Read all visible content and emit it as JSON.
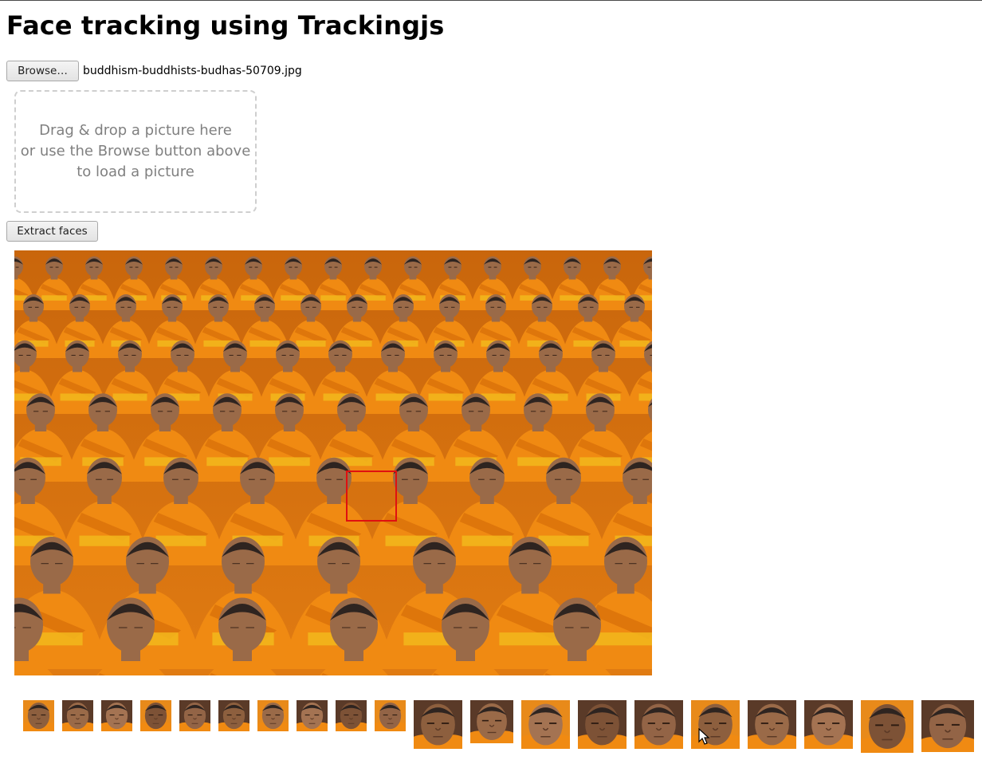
{
  "page": {
    "title": "Face tracking using Trackingjs"
  },
  "file_input": {
    "browse_label": "Browse…",
    "selected_file": "buddhism-buddhists-budhas-50709.jpg"
  },
  "dropzone": {
    "line1": "Drag & drop a picture here",
    "line2": "or use the Browse button above",
    "line3": "to load a picture"
  },
  "actions": {
    "extract_label": "Extract faces"
  },
  "photo": {
    "description": "photo-of-monks-in-orange-robes",
    "face_box_color": "#e01010"
  },
  "extracted_faces": {
    "count": 20
  },
  "colors": {
    "robe_orange": "#f08a12",
    "skin": "#9a6a48",
    "hair": "#2e2420",
    "button_border": "#a9a9a9",
    "dropzone_border": "#cfcfcf",
    "dropzone_text": "#808080"
  }
}
